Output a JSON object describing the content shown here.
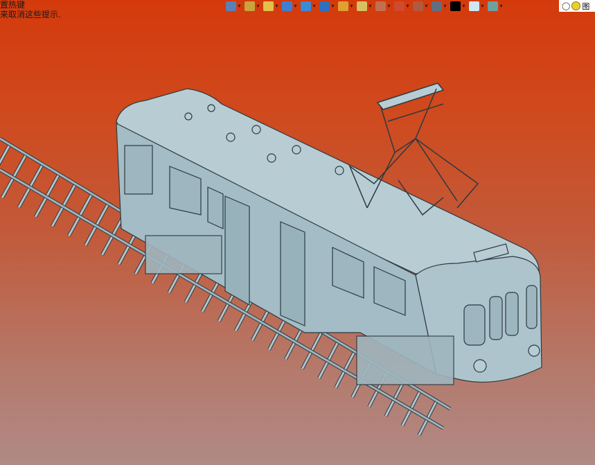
{
  "status_hint": {
    "line1": "置热键",
    "line2": "来取消这些提示."
  },
  "toolbar": {
    "items": [
      {
        "name": "previous-view-icon",
        "color": "#5b7fb8"
      },
      {
        "name": "view-orientation-icon",
        "color": "#c9a43a"
      },
      {
        "name": "sketch-pen-icon",
        "color": "#e3c04a"
      },
      {
        "name": "appearance-icon",
        "color": "#3f7fd0"
      },
      {
        "name": "display-style-icon",
        "color": "#3a8bd6"
      },
      {
        "name": "hide-show-icon",
        "color": "#2f6fbf"
      },
      {
        "name": "section-view-icon",
        "color": "#e0a030"
      },
      {
        "name": "zoom-icon",
        "color": "#d8c060"
      },
      {
        "name": "rotate-icon",
        "color": "#c07050"
      },
      {
        "name": "view-settings-icon",
        "color": "#d04a30"
      },
      {
        "name": "viewport-icon",
        "color": "#b05a40"
      },
      {
        "name": "monitor-icon",
        "color": "#607080"
      },
      {
        "name": "color-black-icon",
        "color": "#000000"
      },
      {
        "name": "color-lightblue-icon",
        "color": "#cfe6f5"
      },
      {
        "name": "scene-icon",
        "color": "#6fa0a0"
      }
    ],
    "corner_label": "图"
  },
  "colors": {
    "body": "#a8c0c8",
    "outline": "#2b3a40",
    "rail": "#8a9ea6"
  }
}
